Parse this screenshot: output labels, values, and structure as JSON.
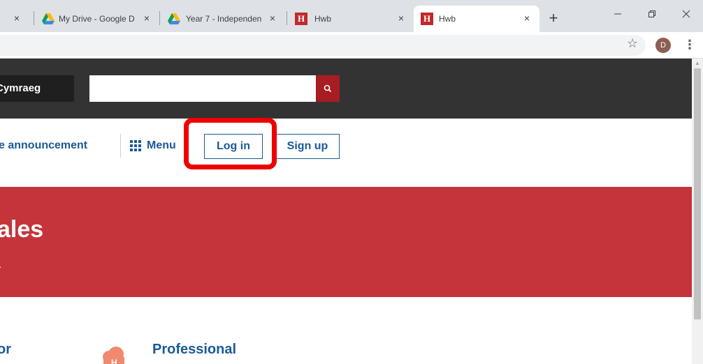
{
  "browser": {
    "tabs": [
      {
        "title": "",
        "favicon": "tab-icon"
      },
      {
        "title": "My Drive - Google D",
        "favicon": "google-drive-icon"
      },
      {
        "title": "Year 7 - Independen",
        "favicon": "google-drive-icon"
      },
      {
        "title": "Hwb",
        "favicon": "hwb-icon"
      },
      {
        "title": "Hwb",
        "favicon": "hwb-icon",
        "active": true
      }
    ],
    "close_glyph": "×",
    "new_tab_glyph": "+",
    "hwb_favicon_letter": "H",
    "profile_initial": "D",
    "window_controls": [
      "minimize-icon",
      "restore-icon",
      "close-icon"
    ]
  },
  "header": {
    "language_label": "Cymraeg",
    "search_placeholder": "",
    "search_icon": "search-icon"
  },
  "nav": {
    "announcement_label": "e announcement",
    "menu_label": "Menu",
    "login_label": "Log in",
    "signup_label": "Sign up"
  },
  "hero": {
    "title": "ales",
    "subtitle": "s."
  },
  "sections": {
    "left_heading": "or",
    "right_heading": "Professional"
  },
  "colors": {
    "topbar": "#333333",
    "hero": "#c4343a",
    "link_blue": "#1a5a96",
    "highlight": "#ee0000"
  }
}
